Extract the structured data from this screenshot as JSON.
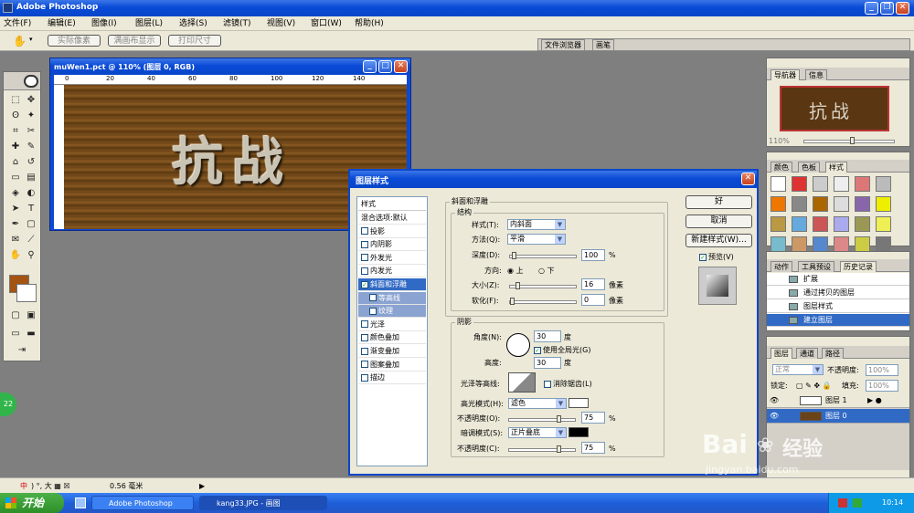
{
  "app_title": "Adobe Photoshop",
  "menu": [
    "文件(F)",
    "编辑(E)",
    "图像(I)",
    "图层(L)",
    "选择(S)",
    "滤镜(T)",
    "视图(V)",
    "窗口(W)",
    "帮助(H)"
  ],
  "options_bar": {
    "actual_pixels": "实际像素",
    "fit_screen": "满画布显示",
    "print_size": "打印尺寸"
  },
  "palette_well": {
    "file_browser": "文件浏览器",
    "brushes": "画笔"
  },
  "document": {
    "title": "muWen1.pct @ 110% (图层 0, RGB)",
    "ruler_labels": [
      "0",
      "20",
      "40",
      "60",
      "80",
      "100",
      "120",
      "140"
    ],
    "artwork_text": "抗战"
  },
  "dialog": {
    "title": "图层样式",
    "styles_header": "样式",
    "style_items": [
      {
        "label": "混合选项:默认",
        "checkbox": false
      },
      {
        "label": "投影",
        "checkbox": true,
        "checked": false
      },
      {
        "label": "内阴影",
        "checkbox": true,
        "checked": false
      },
      {
        "label": "外发光",
        "checkbox": true,
        "checked": false
      },
      {
        "label": "内发光",
        "checkbox": true,
        "checked": false
      },
      {
        "label": "斜面和浮雕",
        "checkbox": true,
        "checked": true,
        "selected": true
      },
      {
        "label": "等高线",
        "checkbox": true,
        "checked": false,
        "sub": true
      },
      {
        "label": "纹理",
        "checkbox": true,
        "checked": false,
        "sub": true
      },
      {
        "label": "光泽",
        "checkbox": true,
        "checked": false
      },
      {
        "label": "颜色叠加",
        "checkbox": true,
        "checked": false
      },
      {
        "label": "渐变叠加",
        "checkbox": true,
        "checked": false
      },
      {
        "label": "图案叠加",
        "checkbox": true,
        "checked": false
      },
      {
        "label": "描边",
        "checkbox": true,
        "checked": false
      }
    ],
    "bevel": {
      "group_title": "斜面和浮雕",
      "structure_title": "结构",
      "style_label": "样式(T):",
      "style_value": "内斜面",
      "technique_label": "方法(Q):",
      "technique_value": "平滑",
      "depth_label": "深度(D):",
      "depth_value": "100",
      "depth_unit": "%",
      "direction_label": "方向:",
      "dir_up": "上",
      "dir_down": "下",
      "size_label": "大小(Z):",
      "size_value": "16",
      "size_unit": "像素",
      "soften_label": "软化(F):",
      "soften_value": "0",
      "soften_unit": "像素"
    },
    "shading": {
      "title": "阴影",
      "angle_label": "角度(N):",
      "angle_value": "30",
      "angle_unit": "度",
      "global_light": "使用全局光(G)",
      "altitude_label": "高度:",
      "altitude_value": "30",
      "altitude_unit": "度",
      "gloss_label": "光泽等高线:",
      "anti_alias": "消除锯齿(L)",
      "highlight_label": "高光模式(H):",
      "highlight_value": "滤色",
      "highlight_color": "#ffffff",
      "hl_opacity_label": "不透明度(O):",
      "hl_opacity_value": "75",
      "hl_opacity_unit": "%",
      "shadow_label": "暗调模式(S):",
      "shadow_value": "正片叠底",
      "shadow_color": "#000000",
      "sh_opacity_label": "不透明度(C):",
      "sh_opacity_value": "75",
      "sh_opacity_unit": "%"
    },
    "buttons": {
      "ok": "好",
      "cancel": "取消",
      "new_style": "新建样式(W)...",
      "preview": "预览(V)"
    }
  },
  "navigator": {
    "tab1": "导航器",
    "tab2": "信息",
    "zoom": "110%",
    "thumb_text": "抗战"
  },
  "color_panel": {
    "tabs": [
      "颜色",
      "色板",
      "样式"
    ]
  },
  "history": {
    "tabs": [
      "动作",
      "工具预设",
      "历史记录"
    ],
    "items": [
      "扩展",
      "通过拷贝的图层",
      "图层样式",
      "建立图层"
    ]
  },
  "layers": {
    "tabs": [
      "图层",
      "通道",
      "路径"
    ],
    "blend": "正常",
    "opacity_label": "不透明度:",
    "opacity_value": "100%",
    "lock_label": "锁定:",
    "fill_label": "填充:",
    "fill_value": "100%",
    "items": [
      "图层 1",
      "图层 0"
    ]
  },
  "status": {
    "ime": "中",
    "zoom_value": "0.56 毫米"
  },
  "taskbar": {
    "start": "开始",
    "item1": "Adobe Photoshop",
    "item2": "kang33.JPG - 画图",
    "clock": "10:14"
  },
  "badge": "22",
  "watermark": {
    "line1": "Bai",
    "line2": "经验",
    "line3": "jingyan.baidu.com"
  }
}
